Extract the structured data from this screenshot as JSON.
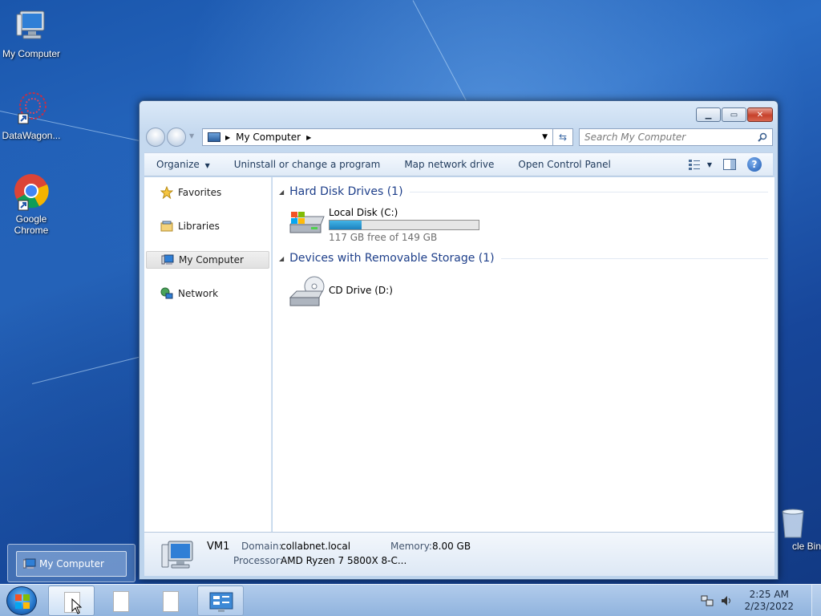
{
  "desktop": {
    "icons": [
      {
        "label": "My Computer"
      },
      {
        "label": "DataWagon..."
      },
      {
        "label": "Google Chrome"
      },
      {
        "label": "cle Bin"
      }
    ]
  },
  "window": {
    "address": {
      "location": "My Computer"
    },
    "search_placeholder": "Search My Computer",
    "toolbar": {
      "organize": "Organize",
      "uninstall": "Uninstall or change a program",
      "map_drive": "Map network drive",
      "control_panel": "Open Control Panel",
      "help": "?"
    },
    "nav": {
      "favorites": "Favorites",
      "libraries": "Libraries",
      "my_computer": "My Computer",
      "network": "Network"
    },
    "groups": {
      "hdd": {
        "title": "Hard Disk Drives (1)",
        "drive_name": "Local Disk (C:)",
        "free_text": "117 GB free of 149 GB",
        "used_fraction": 0.215
      },
      "removable": {
        "title": "Devices with Removable Storage (1)",
        "drive_name": "CD Drive (D:)"
      }
    },
    "details": {
      "computer_name": "VM1",
      "domain_label": "Domain:",
      "domain_value": "collabnet.local",
      "memory_label": "Memory:",
      "memory_value": "8.00 GB",
      "processor_label": "Processor:",
      "processor_value": "AMD Ryzen 7 5800X 8-C..."
    }
  },
  "preview": {
    "label": "My Computer"
  },
  "taskbar": {
    "time": "2:25 AM",
    "date": "2/23/2022"
  },
  "colors": {
    "accent": "#1e3f8a",
    "progress": "#1c82bf"
  }
}
